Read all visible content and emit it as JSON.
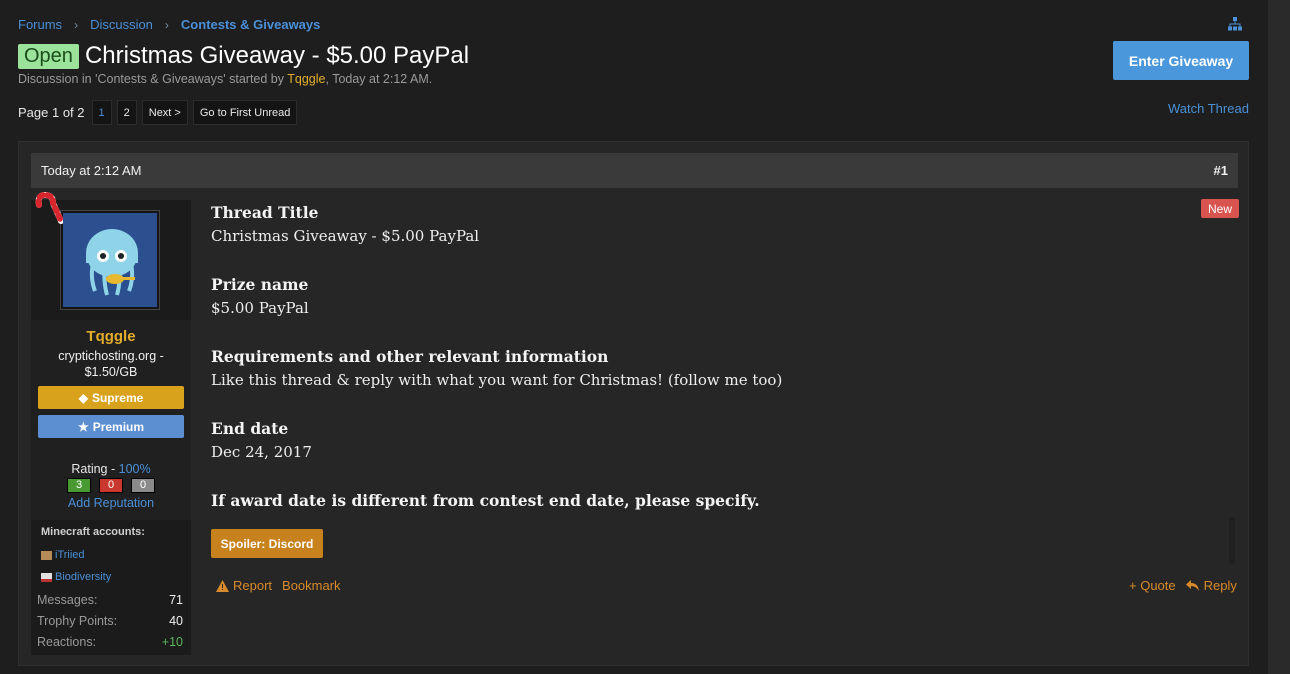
{
  "breadcrumb": {
    "items": [
      "Forums",
      "Discussion",
      "Contests & Giveaways"
    ]
  },
  "thread": {
    "prefix": "Open",
    "title": "Christmas Giveaway - $5.00 PayPal",
    "meta_prefix": "Discussion in 'Contests & Giveaways' started by ",
    "author": "Tqggle",
    "meta_suffix": ", Today at 2:12 AM."
  },
  "actions": {
    "enter_giveaway": "Enter Giveaway",
    "watch_thread": "Watch Thread"
  },
  "pager": {
    "label": "Page 1 of 2",
    "pages": [
      "1",
      "2"
    ],
    "next": "Next >",
    "first_unread": "Go to First Unread"
  },
  "post": {
    "date": "Today at 2:12 AM",
    "number": "#1",
    "new_badge": "New",
    "sections": [
      {
        "heading": "Thread Title",
        "text": "Christmas Giveaway - $5.00 PayPal"
      },
      {
        "heading": "Prize name",
        "text": "$5.00 PayPal"
      },
      {
        "heading": "Requirements and other relevant information",
        "text": "Like this thread & reply with what you want for Christmas! (follow me too)"
      },
      {
        "heading": "End date",
        "text": "Dec 24, 2017"
      },
      {
        "heading": "If award date is different from contest end date, please specify.",
        "text": ""
      }
    ],
    "spoiler": "Spoiler: Discord",
    "report": "Report",
    "bookmark": "Bookmark",
    "quote": "+ Quote",
    "reply": "Reply"
  },
  "user": {
    "name": "Tqggle",
    "title_line1": "cryptichosting.org -",
    "title_line2": "$1.50/GB",
    "badge_supreme": "Supreme",
    "badge_premium": "Premium",
    "rating_label": "Rating - ",
    "rating_pct": "100%",
    "rep_positive": "3",
    "rep_negative": "0",
    "rep_neutral": "0",
    "add_reputation": "Add Reputation",
    "minecraft_title": "Minecraft accounts:",
    "minecraft_accounts": [
      "iTriied",
      "Biodiversity"
    ],
    "stats": [
      {
        "label": "Messages:",
        "value": "71"
      },
      {
        "label": "Trophy Points:",
        "value": "40"
      },
      {
        "label": "Reactions:",
        "value": "+10"
      }
    ]
  },
  "colors": {
    "accent_blue": "#4a97db",
    "username_gold": "#e3ad2b",
    "action_orange": "#d98a2a",
    "prefix_green": "#9be39b"
  }
}
